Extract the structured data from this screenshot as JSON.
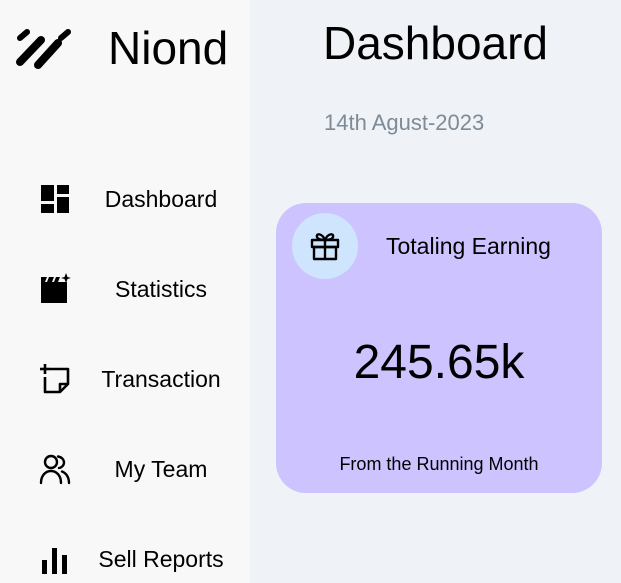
{
  "brand": {
    "name": "Niond",
    "logo_icon": "slash-marks-icon"
  },
  "sidebar": {
    "items": [
      {
        "label": "Dashboard",
        "icon": "dashboard-icon"
      },
      {
        "label": "Statistics",
        "icon": "clapperboard-icon"
      },
      {
        "label": "Transaction",
        "icon": "sticky-note-add-icon"
      },
      {
        "label": "My Team",
        "icon": "users-icon"
      },
      {
        "label": "Sell Reports",
        "icon": "bar-chart-icon"
      }
    ]
  },
  "main": {
    "title": "Dashboard",
    "date": "14th Agust-2023"
  },
  "earning_card": {
    "icon": "gift-icon",
    "title": "Totaling Earning",
    "value": "245.65k",
    "subtitle": "From the Running Month"
  },
  "colors": {
    "sidebar_bg": "#f8f8f9",
    "main_bg": "#eff2f6",
    "card_bg": "#cdc3ff",
    "card_icon_bg": "#cfe5fd",
    "date_text": "#7d8b98"
  }
}
